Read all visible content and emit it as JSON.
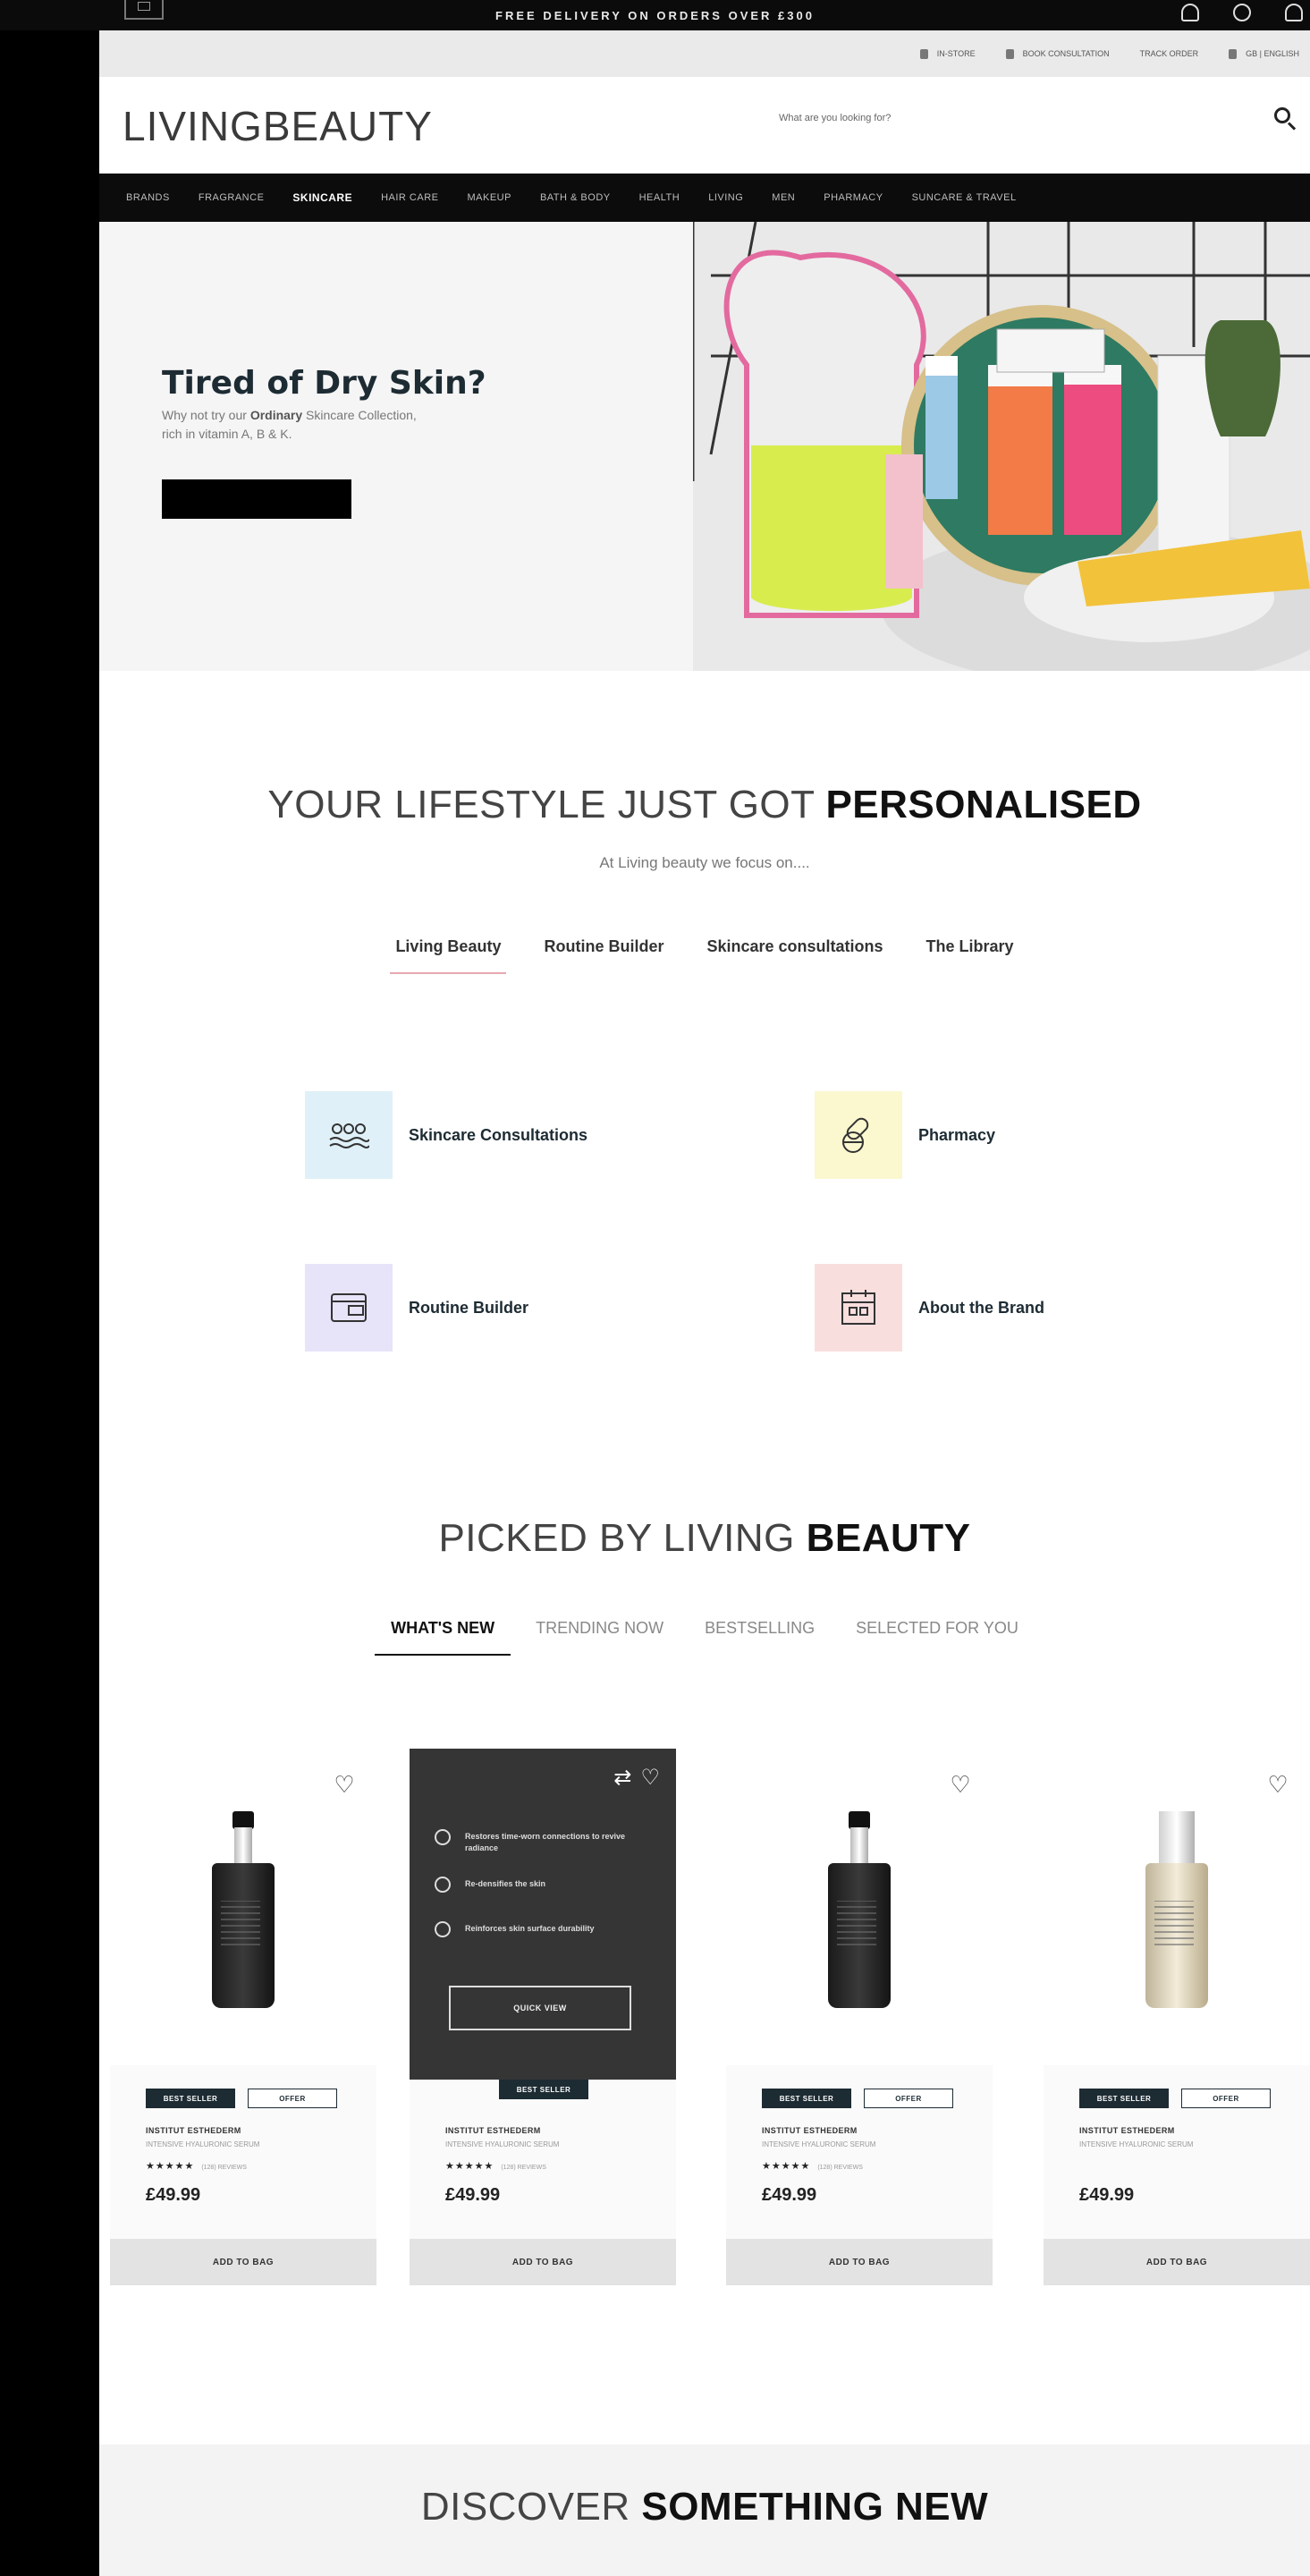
{
  "promo": {
    "text": "FREE DELIVERY ON ORDERS OVER £300"
  },
  "utility": [
    {
      "label": "IN-STORE"
    },
    {
      "label": "BOOK CONSULTATION"
    },
    {
      "label": "TRACK ORDER"
    },
    {
      "label": "GB | ENGLISH"
    }
  ],
  "header": {
    "logo": "LIVINGBEAUTY",
    "search_placeholder": "What are you looking for?"
  },
  "nav": [
    "BRANDS",
    "FRAGRANCE",
    "SKINCARE",
    "HAIR CARE",
    "MAKEUP",
    "BATH & BODY",
    "HEALTH",
    "LIVING",
    "MEN",
    "PHARMACY",
    "SUNCARE & TRAVEL"
  ],
  "hero": {
    "title": "Tired of Dry Skin?",
    "sub_pre": "Why not try our ",
    "sub_bold": "Ordinary",
    "sub_post": " Skincare Collection, rich in vitamin A, B & K."
  },
  "personalised": {
    "title_light": "YOUR LIFESTYLE JUST GOT ",
    "title_bold": "PERSONALISED",
    "subtitle": "At Living beauty we focus on....",
    "tabs": [
      "Living Beauty",
      "Routine Builder",
      "Skincare consultations",
      "The Library"
    ],
    "features": [
      {
        "label": "Skincare Consultations",
        "icon": "consultation-icon",
        "bg": "#dff0f8"
      },
      {
        "label": "Pharmacy",
        "icon": "pills-icon",
        "bg": "#fbf7cf"
      },
      {
        "label": "Routine Builder",
        "icon": "routine-icon",
        "bg": "#e7e3f8"
      },
      {
        "label": "About the Brand",
        "icon": "brand-icon",
        "bg": "#f9dede"
      }
    ]
  },
  "picked": {
    "title_light": "PICKED BY LIVING ",
    "title_bold": "BEAUTY",
    "tabs": [
      "WHAT'S NEW",
      "TRENDING NOW",
      "BESTSELLING",
      "SELECTED FOR YOU"
    ]
  },
  "products": [
    {
      "brand": "INSTITUT ESTHEDERM",
      "desc": "INTENSIVE HYALURONIC SERUM",
      "stars": "★★★★★",
      "reviews": "(128) REVIEWS",
      "price": "£49.99",
      "badge_best": "BEST SELLER",
      "badge_offer": "OFFER",
      "cta": "ADD TO BAG"
    },
    {
      "brand": "INSTITUT ESTHEDERM",
      "desc": "INTENSIVE HYALURONIC SERUM",
      "stars": "★★★★★",
      "reviews": "(128) REVIEWS",
      "price": "£49.99",
      "badge_best": "BEST SELLER",
      "cta": "ADD TO BAG",
      "overlay": {
        "benefits": [
          "Restores time-worn connections to revive radiance",
          "Re-densifies the skin",
          "Reinforces skin surface durability"
        ],
        "quick_view": "QUICK VIEW"
      }
    },
    {
      "brand": "INSTITUT ESTHEDERM",
      "desc": "INTENSIVE HYALURONIC SERUM",
      "stars": "★★★★★",
      "reviews": "(128) REVIEWS",
      "price": "£49.99",
      "badge_best": "BEST SELLER",
      "badge_offer": "OFFER",
      "cta": "ADD TO BAG"
    },
    {
      "brand": "INSTITUT ESTHEDERM",
      "desc": "INTENSIVE HYALURONIC SERUM",
      "stars": "",
      "reviews": "",
      "price": "£49.99",
      "badge_best": "BEST SELLER",
      "badge_offer": "OFFER",
      "cta": "ADD TO BAG"
    }
  ],
  "discover": {
    "title_light": "DISCOVER ",
    "title_bold": "SOMETHING NEW"
  }
}
